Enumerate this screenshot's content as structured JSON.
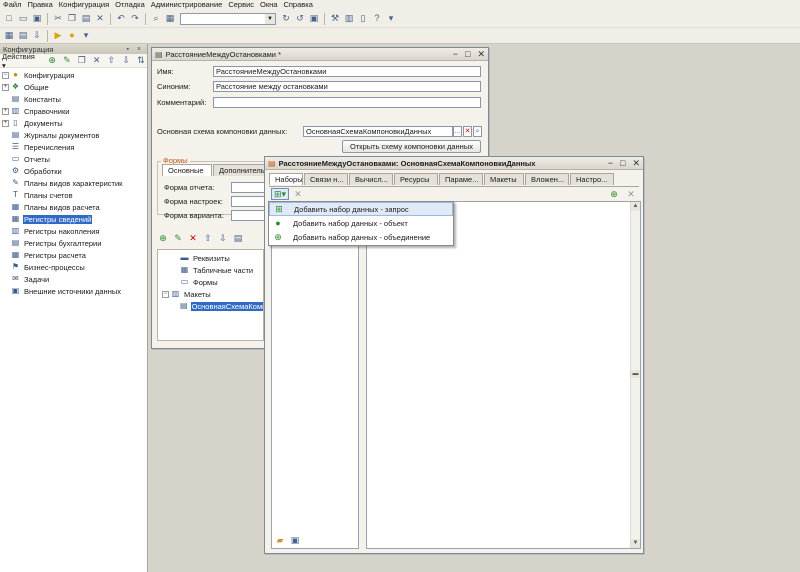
{
  "menu": [
    "Файл",
    "Правка",
    "Конфигурация",
    "Отладка",
    "Администрирование",
    "Сервис",
    "Окна",
    "Справка"
  ],
  "config_panel": {
    "title": "Конфигурация",
    "actions_label": "Действия",
    "root": "Конфигурация",
    "items": [
      {
        "label": "Общие",
        "icon": "common-icon",
        "expander": "+"
      },
      {
        "label": "Константы",
        "icon": "constants-icon",
        "expander": ""
      },
      {
        "label": "Справочники",
        "icon": "catalogs-icon",
        "expander": "+"
      },
      {
        "label": "Документы",
        "icon": "documents-icon",
        "expander": "+"
      },
      {
        "label": "Журналы документов",
        "icon": "journals-icon",
        "expander": ""
      },
      {
        "label": "Перечисления",
        "icon": "enums-icon",
        "expander": ""
      },
      {
        "label": "Отчеты",
        "icon": "reports-icon",
        "expander": ""
      },
      {
        "label": "Обработки",
        "icon": "processors-icon",
        "expander": ""
      },
      {
        "label": "Планы видов характеристик",
        "icon": "char-types-icon",
        "expander": ""
      },
      {
        "label": "Планы счетов",
        "icon": "chart-accounts-icon",
        "expander": ""
      },
      {
        "label": "Планы видов расчета",
        "icon": "calc-types-icon",
        "expander": ""
      },
      {
        "label": "Регистры сведений",
        "icon": "info-registers-icon",
        "expander": "",
        "selected": true
      },
      {
        "label": "Регистры накопления",
        "icon": "accum-registers-icon",
        "expander": ""
      },
      {
        "label": "Регистры бухгалтерии",
        "icon": "acc-registers-icon",
        "expander": ""
      },
      {
        "label": "Регистры расчета",
        "icon": "calc-registers-icon",
        "expander": ""
      },
      {
        "label": "Бизнес-процессы",
        "icon": "business-process-icon",
        "expander": ""
      },
      {
        "label": "Задачи",
        "icon": "tasks-icon",
        "expander": ""
      },
      {
        "label": "Внешние источники данных",
        "icon": "external-sources-icon",
        "expander": ""
      }
    ]
  },
  "form_window": {
    "title": "РасстояниеМеждуОстановками *",
    "name_label": "Имя:",
    "name_value": "РасстояниеМеждуОстановками",
    "synonym_label": "Синоним:",
    "synonym_value": "Расстояние между остановками",
    "comment_label": "Комментарий:",
    "comment_value": "",
    "schema_label": "Основная схема компоновки данных:",
    "schema_value": "ОсновнаяСхемаКомпоновкиДанных",
    "open_schema_button": "Открыть схему компоновки данных",
    "forms_group": "Формы",
    "tabs": [
      "Основные",
      "Дополнительн..."
    ],
    "report_form_label": "Форма отчета:",
    "settings_form_label": "Форма настроек:",
    "variant_form_label": "Форма варианта:",
    "tree": [
      {
        "label": "Реквизиты",
        "icon": "attributes-icon",
        "expander": "",
        "indent": 1
      },
      {
        "label": "Табличные части",
        "icon": "tabular-sections-icon",
        "expander": "",
        "indent": 1
      },
      {
        "label": "Формы",
        "icon": "forms-icon",
        "expander": "",
        "indent": 1
      },
      {
        "label": "Макеты",
        "icon": "templates-icon",
        "expander": "−",
        "indent": 0
      },
      {
        "label": "ОсновнаяСхемаКомпоновкиДанных",
        "icon": "template-item-icon",
        "expander": "",
        "indent": 2,
        "selected": true
      }
    ]
  },
  "dialog": {
    "title": "РасстояниеМеждуОстановками: ОсновнаяСхемаКомпоновкиДанных",
    "tabs": [
      "Наборы...",
      "Связи н...",
      "Вычисл...",
      "Ресурсы",
      "Параме...",
      "Макеты",
      "Вложен...",
      "Настро..."
    ],
    "menu_items": [
      {
        "label": "Добавить набор данных - запрос",
        "icon": "query-dataset-icon"
      },
      {
        "label": "Добавить набор данных - объект",
        "icon": "object-dataset-icon"
      },
      {
        "label": "Добавить набор данных - объединение",
        "icon": "union-dataset-icon"
      }
    ]
  }
}
